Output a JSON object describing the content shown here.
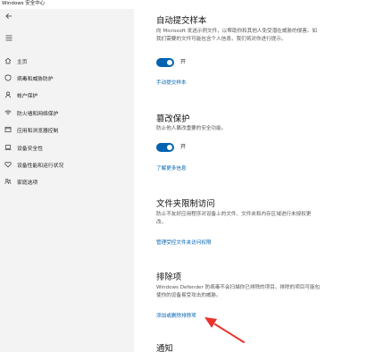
{
  "window": {
    "title": "Windows 安全中心"
  },
  "sidebar": {
    "items": [
      {
        "label": "主页",
        "icon": "home-icon"
      },
      {
        "label": "病毒和威胁防护",
        "icon": "shield-icon"
      },
      {
        "label": "帐户保护",
        "icon": "person-icon"
      },
      {
        "label": "防火墙和网络保护",
        "icon": "wifi-icon"
      },
      {
        "label": "应用和浏览器控制",
        "icon": "app-window-icon"
      },
      {
        "label": "设备安全性",
        "icon": "laptop-icon"
      },
      {
        "label": "设备性能和运行状况",
        "icon": "heart-icon"
      },
      {
        "label": "家庭选项",
        "icon": "family-icon"
      }
    ]
  },
  "auto_submit": {
    "title": "自动提交样本",
    "desc1": "向 Microsoft 发送示例文件，以帮助你和其他人免受潜在威胁的侵害。如",
    "desc2": "我们需要的文件可能包含个人信息，我们将对你进行提示。",
    "toggle_label": "开",
    "link": "手动提交样本"
  },
  "tamper": {
    "title": "篡改保护",
    "desc": "防止他人篡改重要的安全功能。",
    "toggle_label": "开",
    "link": "了解更多信息"
  },
  "folder_access": {
    "title": "文件夹限制访问",
    "desc1": "防止不友好应用程序对设备上的文件、文件夹和内存区域进行未授权更",
    "desc2": "改。",
    "link": "管理受控文件夹访问权限"
  },
  "exclusions": {
    "title": "排除项",
    "desc1": "Windows Defender 防病毒不会扫描你已排除的项目。排除的项目可能包",
    "desc2": "使你的设备易受攻击的威胁。",
    "link": "添加或删除排除项"
  },
  "notifications": {
    "title": "通知"
  },
  "colors": {
    "accent": "#0063b1",
    "annotation_arrow": "#e8322a"
  }
}
